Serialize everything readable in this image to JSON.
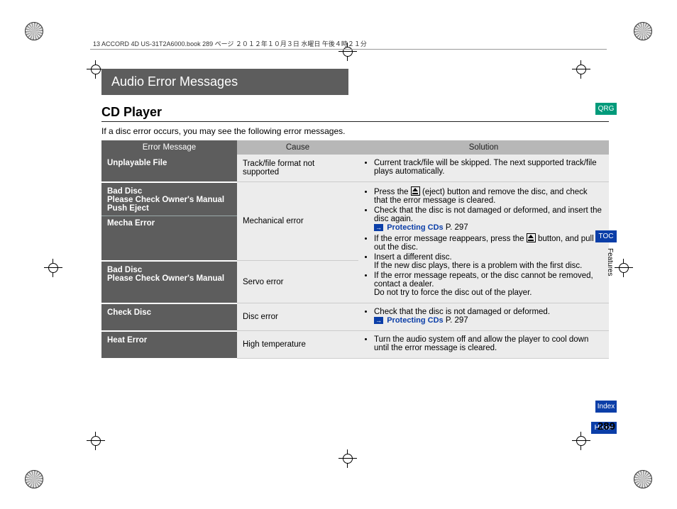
{
  "header_strip": "13 ACCORD 4D US-31T2A6000.book  289 ページ  ２０１２年１０月３日  水曜日  午後４時２１分",
  "title": "Audio Error Messages",
  "subtitle": "CD Player",
  "intro": "If a disc error occurs, you may see the following error messages.",
  "columns": {
    "c1": "Error Message",
    "c2": "Cause",
    "c3": "Solution"
  },
  "rows": {
    "r1": {
      "msg": "Unplayable File",
      "cause": "Track/file format not supported",
      "sol1": "Current track/file will be skipped. The next supported track/file plays automatically."
    },
    "r2": {
      "msgA": "Bad Disc",
      "msgB": "Please Check Owner's Manual",
      "msgC": "Push Eject",
      "msgD": "Mecha Error",
      "cause": "Mechanical error"
    },
    "r3": {
      "msgA": "Bad Disc",
      "msgB": "Please Check Owner's Manual",
      "cause": "Servo error"
    },
    "sol_big": {
      "s1a": "Press the ",
      "s1b": " (eject) button and remove the disc, and check that the error message is cleared.",
      "s2": "Check that the disc is not damaged or deformed, and insert the disc again.",
      "ref1": "Protecting CDs",
      "ref1p": " P. 297",
      "s3a": "If the error message reappears, press the ",
      "s3b": " button, and pull out the disc.",
      "s4": "Insert a different disc.",
      "s4n": "If the new disc plays, there is a problem with the first disc.",
      "s5": "If the error message repeats, or the disc cannot be removed, contact a dealer.",
      "s5n": "Do not try to force the disc out of the player."
    },
    "r4": {
      "msg": "Check Disc",
      "cause": "Disc error",
      "sol": "Check that the disc is not damaged or deformed.",
      "ref": "Protecting CDs",
      "refp": " P. 297"
    },
    "r5": {
      "msg": "Heat Error",
      "cause": "High temperature",
      "sol": "Turn the audio system off and allow the player to cool down until the error message is cleared."
    }
  },
  "tabs": {
    "qrg": "QRG",
    "toc": "TOC",
    "idx": "Index",
    "home": "Home",
    "features": "Features"
  },
  "page_number": "289"
}
